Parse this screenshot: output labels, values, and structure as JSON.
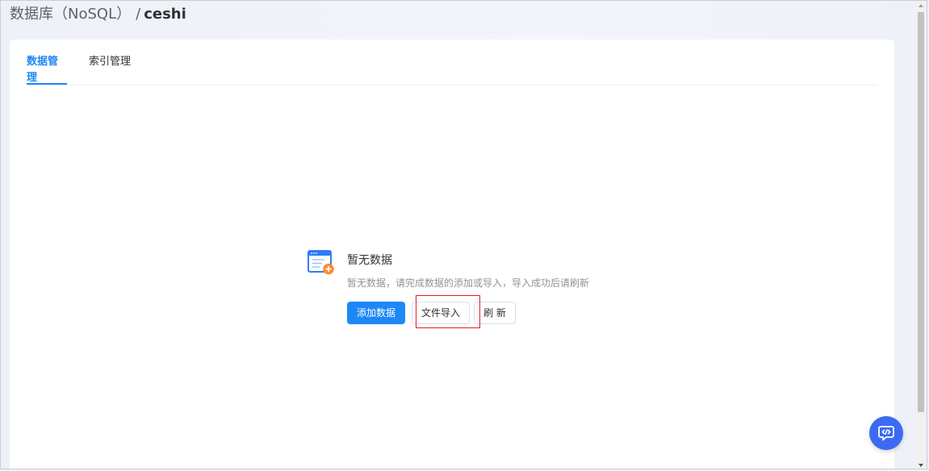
{
  "breadcrumb": {
    "root": "数据库（NoSQL）",
    "separator": "/",
    "current": "ceshi"
  },
  "tabs": [
    {
      "label": "数据管理",
      "active": true
    },
    {
      "label": "索引管理",
      "active": false
    }
  ],
  "empty_state": {
    "icon": "add-document-icon",
    "title": "暂无数据",
    "description": "暂无数据，请完成数据的添加或导入，导入成功后请刷新"
  },
  "actions": {
    "add": "添加数据",
    "import": "文件导入",
    "refresh": "刷 新"
  },
  "floating": {
    "icon": "code-chat-icon"
  },
  "colors": {
    "primary": "#1d88f5",
    "highlight": "#e02020",
    "fab": "#3d6af2"
  }
}
